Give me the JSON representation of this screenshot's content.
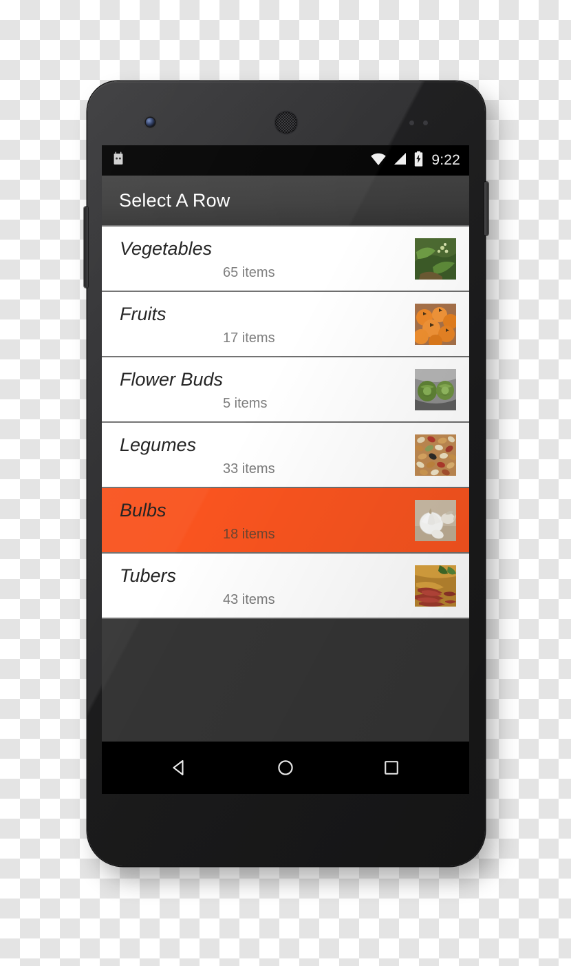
{
  "device": {
    "type": "android-phone-mockup",
    "camera_icon": "front-camera-icon",
    "speaker_icon": "earpiece-speaker-icon",
    "sensor_icon": "proximity-sensor-icon"
  },
  "status_bar": {
    "notification_icon": "android-robot-icon",
    "wifi_icon": "wifi-full-icon",
    "signal_icon": "cellular-signal-icon",
    "battery_icon": "battery-charging-icon",
    "clock": "9:22"
  },
  "action_bar": {
    "title": "Select A Row"
  },
  "list": {
    "rows": [
      {
        "title": "Vegetables",
        "subtitle": "65 items",
        "thumb": "leafy-green-plant-thumbnail",
        "selected": false
      },
      {
        "title": "Fruits",
        "subtitle": "17 items",
        "thumb": "orange-persimmons-thumbnail",
        "selected": false
      },
      {
        "title": "Flower Buds",
        "subtitle": "5 items",
        "thumb": "artichokes-in-pot-thumbnail",
        "selected": false
      },
      {
        "title": "Legumes",
        "subtitle": "33 items",
        "thumb": "mixed-dried-beans-thumbnail",
        "selected": false
      },
      {
        "title": "Bulbs",
        "subtitle": "18 items",
        "thumb": "garlic-bulb-thumbnail",
        "selected": true
      },
      {
        "title": "Tubers",
        "subtitle": "43 items",
        "thumb": "red-root-vegetables-thumbnail",
        "selected": false
      }
    ]
  },
  "nav_bar": {
    "back_icon": "back-triangle-icon",
    "home_icon": "home-circle-icon",
    "recents_icon": "recents-square-icon"
  },
  "colors": {
    "selected_row": "#f9541f",
    "action_bar": "#3c3c3c",
    "status_bar": "#000000",
    "divider": "#6e6e6e",
    "row_background": "#ffffff",
    "subtitle_text": "#7a7a7a",
    "empty_area": "#353535"
  }
}
